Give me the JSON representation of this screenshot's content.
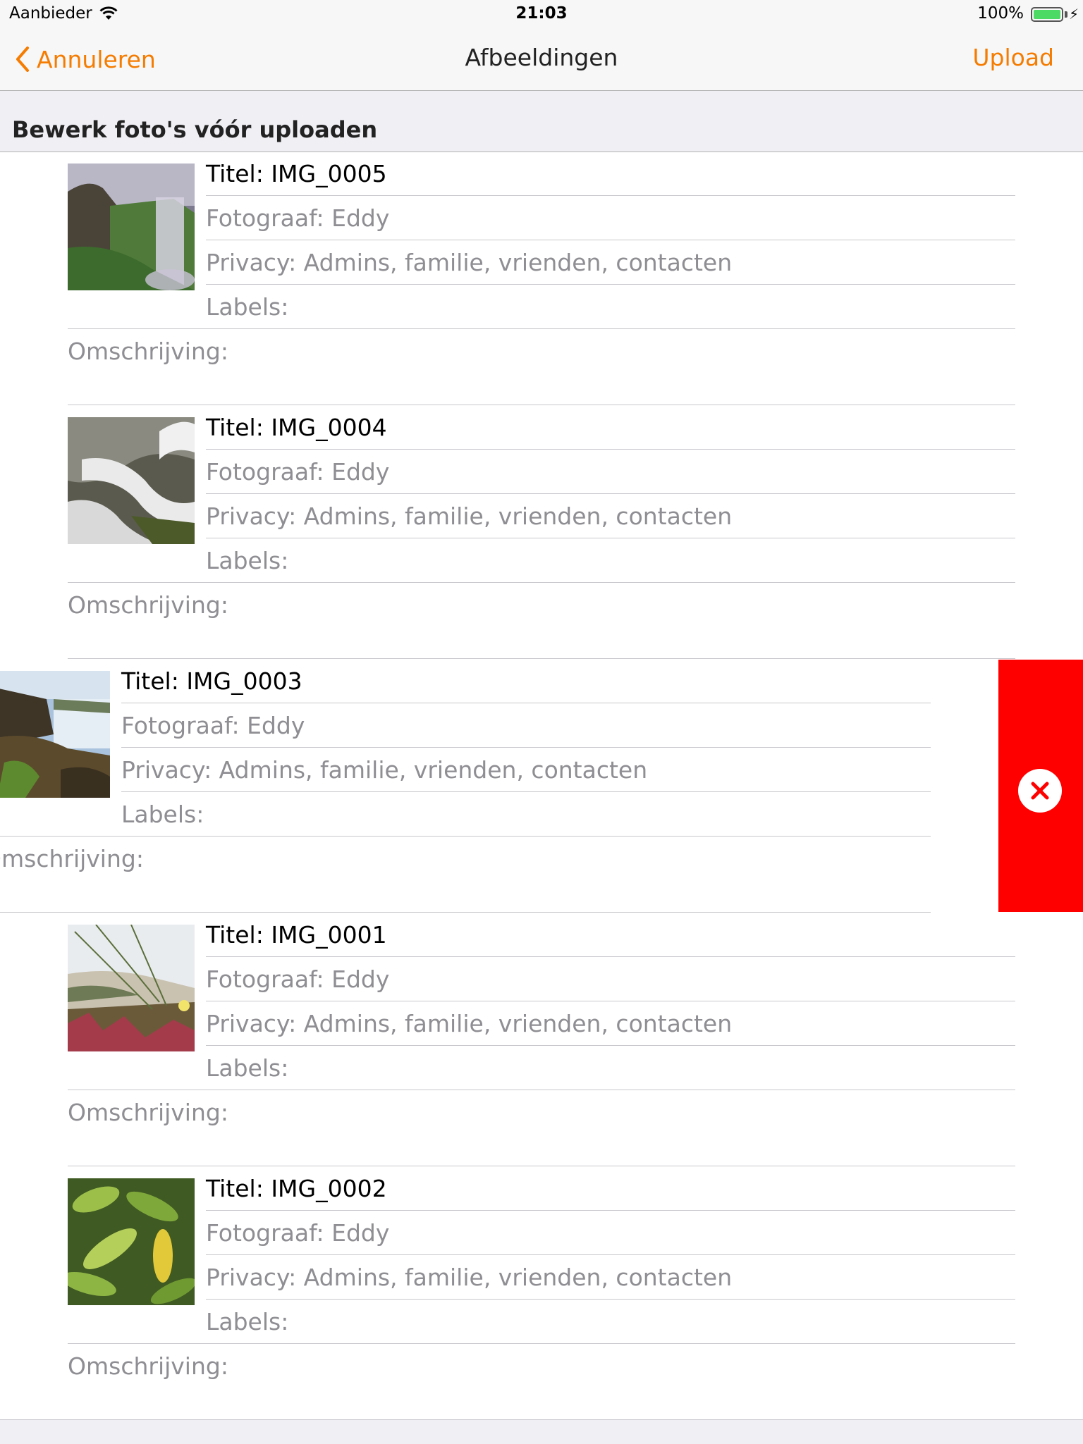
{
  "status_bar": {
    "carrier": "Aanbieder",
    "time": "21:03",
    "battery": "100%"
  },
  "nav": {
    "back_label": "Annuleren",
    "title": "Afbeeldingen",
    "upload_label": "Upload",
    "accent_color": "#f57c00"
  },
  "section": {
    "header": "Bewerk foto's vóór uploaden"
  },
  "photos": [
    {
      "title": "Titel: IMG_0005",
      "photographer": "Fotograaf: Eddy",
      "privacy": "Privacy: Admins, familie, vrienden, contacten",
      "labels": "Labels:",
      "description": "Omschrijving:",
      "thumbnail": "waterfall-cliff-photo"
    },
    {
      "title": "Titel: IMG_0004",
      "photographer": "Fotograaf: Eddy",
      "privacy": "Privacy: Admins, familie, vrienden, contacten",
      "labels": "Labels:",
      "description": "Omschrijving:",
      "thumbnail": "rushing-water-rocks-photo"
    },
    {
      "title": "Titel: IMG_0003",
      "photographer": "Fotograaf: Eddy",
      "privacy": "Privacy: Admins, familie, vrienden, contacten",
      "labels": "Labels:",
      "description": "Omschrijving:",
      "thumbnail": "waterfall-landscape-photo",
      "swiped": true
    },
    {
      "title": "Titel: IMG_0001",
      "photographer": "Fotograaf: Eddy",
      "privacy": "Privacy: Admins, familie, vrienden, contacten",
      "labels": "Labels:",
      "description": "Omschrijving:",
      "thumbnail": "dune-grass-flowers-photo"
    },
    {
      "title": "Titel: IMG_0002",
      "photographer": "Fotograaf: Eddy",
      "privacy": "Privacy: Admins, familie, vrienden, contacten",
      "labels": "Labels:",
      "description": "Omschrijving:",
      "thumbnail": "green-leaves-photo"
    }
  ],
  "delete_action": {
    "icon": "close-icon",
    "color": "#ff0000"
  }
}
